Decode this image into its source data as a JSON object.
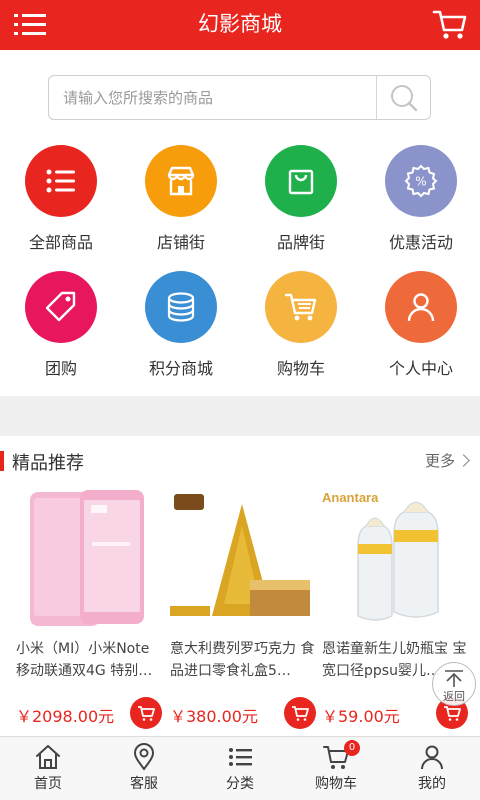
{
  "header": {
    "title": "幻影商城"
  },
  "search": {
    "placeholder": "请输入您所搜索的商品"
  },
  "colors": {
    "brand": "#e8261f"
  },
  "categories": [
    {
      "label": "全部商品",
      "icon": "list-icon",
      "color": "#e8261f"
    },
    {
      "label": "店铺街",
      "icon": "shop-icon",
      "color": "#f79c0a"
    },
    {
      "label": "品牌街",
      "icon": "bag-icon",
      "color": "#20b04b"
    },
    {
      "label": "优惠活动",
      "icon": "discount-icon",
      "color": "#8b93cb"
    },
    {
      "label": "团购",
      "icon": "tag-icon",
      "color": "#e8175d"
    },
    {
      "label": "积分商城",
      "icon": "coins-icon",
      "color": "#3a8ed4"
    },
    {
      "label": "购物车",
      "icon": "cart-icon",
      "color": "#f5b340"
    },
    {
      "label": "个人中心",
      "icon": "user-icon",
      "color": "#ef6a3b"
    }
  ],
  "recommend": {
    "title": "精品推荐",
    "more": "更多",
    "products": [
      {
        "name": "小米（MI）小米Note 移动联通双4G 特别…",
        "price": "￥2098.00元"
      },
      {
        "name": "意大利费列罗巧克力 食品进口零食礼盒5…",
        "price": "￥380.00元"
      },
      {
        "name": "恩诺童新生儿奶瓶宝 宝宽口径ppsu婴儿…",
        "price": "￥59.00元"
      }
    ]
  },
  "back_to_top": "返回",
  "tabbar": [
    {
      "label": "首页",
      "icon": "home-icon"
    },
    {
      "label": "客服",
      "icon": "location-icon"
    },
    {
      "label": "分类",
      "icon": "category-icon"
    },
    {
      "label": "购物车",
      "icon": "cart-icon",
      "badge": "0"
    },
    {
      "label": "我的",
      "icon": "user-icon"
    }
  ]
}
